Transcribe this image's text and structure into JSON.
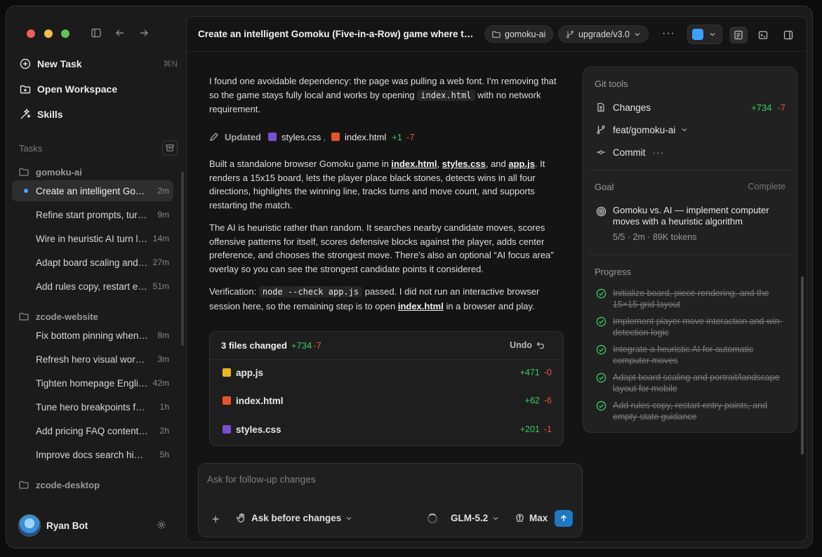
{
  "sidebar": {
    "nav": [
      {
        "label": "New Task",
        "shortcut": "⌘N"
      },
      {
        "label": "Open Workspace",
        "shortcut": ""
      },
      {
        "label": "Skills",
        "shortcut": ""
      }
    ],
    "tasks_label": "Tasks",
    "groups": [
      {
        "name": "gomoku-ai",
        "tasks": [
          {
            "title": "Create an intelligent Gomoku (Five-in-a-Row) game",
            "time": "2m",
            "active": true
          },
          {
            "title": "Refine start prompts, turn indicators",
            "time": "9m"
          },
          {
            "title": "Wire in heuristic AI turn logic",
            "time": "14m"
          },
          {
            "title": "Adapt board scaling and layout",
            "time": "27m"
          },
          {
            "title": "Add rules copy, restart entry points",
            "time": "51m"
          }
        ]
      },
      {
        "name": "zcode-website",
        "tasks": [
          {
            "title": "Fix bottom pinning when scrolling",
            "time": "8m"
          },
          {
            "title": "Refresh hero visual workflow",
            "time": "3m"
          },
          {
            "title": "Tighten homepage English copy",
            "time": "42m"
          },
          {
            "title": "Tune hero breakpoints for tablets",
            "time": "1h"
          },
          {
            "title": "Add pricing FAQ content blocks",
            "time": "2h"
          },
          {
            "title": "Improve docs search highlighting",
            "time": "5h"
          }
        ]
      },
      {
        "name": "zcode-desktop",
        "tasks": []
      }
    ],
    "user": {
      "name": "Ryan Bot"
    }
  },
  "topbar": {
    "title": "Create an intelligent Gomoku (Five-in-a-Row) game where the player plays against AI",
    "workspace": "gomoku-ai",
    "branch": "upgrade/v3.0"
  },
  "chat": {
    "p1": {
      "a": "I found one avoidable dependency: the page was pulling a web font. I'm removing that so the game stays fully local and works by opening ",
      "code": "index.html",
      "b": " with no network requirement."
    },
    "updated": {
      "label": "Updated",
      "file1": "styles.css",
      "sep": ",",
      "file2": "index.html",
      "plus": "+1",
      "minus": "-7"
    },
    "p2": {
      "a": "Built a standalone browser Gomoku game in ",
      "l1": "index.html",
      "s1": ", ",
      "l2": "styles.css",
      "s2": ", and ",
      "l3": "app.js",
      "b": ". It renders a 15x15 board, lets the player place black stones, detects wins in all four directions, highlights the winning line, tracks turns and move count, and supports restarting the match."
    },
    "p3": "The AI is heuristic rather than random. It searches nearby candidate moves, scores offensive patterns for itself, scores defensive blocks against the player, adds center preference, and chooses the strongest move. There's also an optional “AI focus area” overlay so you can see the strongest candidate points it considered.",
    "p4": {
      "a": "Verification: ",
      "code": "node --check app.js",
      "b": " passed. I did not run an interactive browser session here, so the remaining step is to open ",
      "link": "index.html",
      "c": " in a browser and play."
    }
  },
  "files_card": {
    "title": "3 files changed",
    "plus": "+734",
    "minus": "-7",
    "undo": "Undo",
    "files": [
      {
        "name": "app.js",
        "type": "js",
        "plus": "+471",
        "minus": "-0"
      },
      {
        "name": "index.html",
        "type": "html",
        "plus": "+62",
        "minus": "-6"
      },
      {
        "name": "styles.css",
        "type": "css",
        "plus": "+201",
        "minus": "-1"
      }
    ]
  },
  "composer": {
    "placeholder": "Ask for follow-up changes",
    "mode": "Ask before changes",
    "model": "GLM-5.2",
    "effort": "Max"
  },
  "right_panel": {
    "git_title": "Git tools",
    "changes_label": "Changes",
    "changes_plus": "+734",
    "changes_minus": "-7",
    "branch": "feat/gomoku-ai",
    "commit_label": "Commit",
    "goal_title": "Goal",
    "goal_status": "Complete",
    "goal_text": "Gomoku vs. AI — implement computer moves with a heuristic algorithm",
    "goal_meta": "5/5 · 2m · 89K tokens",
    "progress_title": "Progress",
    "progress": [
      "Initialize board, piece rendering, and the 15×15 grid layout",
      "Implement player move interaction and win-detection logic",
      "Integrate a heuristic AI for automatic computer moves",
      "Adapt board scaling and portrait/landscape layout for mobile",
      "Add rules copy, restart entry points, and empty-state guidance"
    ]
  },
  "colors": {
    "accent": "#1f78c1",
    "added": "#3ccb62",
    "removed": "#e5533d"
  }
}
